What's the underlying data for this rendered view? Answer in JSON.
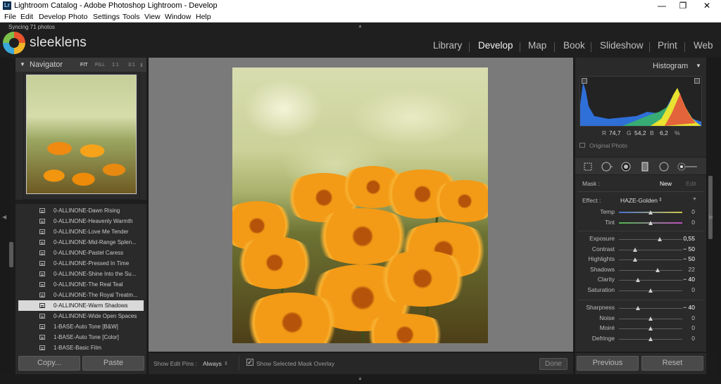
{
  "window": {
    "title": "Lightroom Catalog - Adobe Photoshop Lightroom - Develop",
    "app_icon": "Lr",
    "minimize": "—",
    "maximize": "❐",
    "close": "✕"
  },
  "menu": [
    "File",
    "Edit",
    "Develop",
    "Photo",
    "Settings",
    "Tools",
    "View",
    "Window",
    "Help"
  ],
  "identity": {
    "syncing": "Syncing 71 photos",
    "logo": "sleeklens"
  },
  "modules": [
    "Library",
    "Develop",
    "Map",
    "Book",
    "Slideshow",
    "Print",
    "Web"
  ],
  "active_module": "Develop",
  "navigator": {
    "title": "Navigator",
    "zoom_options": [
      "FIT",
      "FILL",
      "1:1",
      "3:1"
    ],
    "active_zoom": "FIT"
  },
  "presets": [
    "0-ALLINONE-Dawn Rising",
    "0-ALLINONE-Heavenly Warmth",
    "0-ALLINONE-Love Me Tender",
    "0-ALLINONE-Mid-Range Splen...",
    "0-ALLINONE-Pastel Caress",
    "0-ALLINONE-Pressed In Time",
    "0-ALLINONE-Shine Into the Su...",
    "0-ALLINONE-The Real Teal",
    "0-ALLINONE-The Royal Treatm...",
    "0-ALLINONE-Warm Shadows",
    "0-ALLINONE-Wide Open Spaces",
    "1-BASE-Auto Tone [B&W]",
    "1-BASE-Auto Tone [Color]",
    "1-BASE-Basic Film"
  ],
  "selected_preset": "0-ALLINONE-Warm Shadows",
  "left_buttons": {
    "copy": "Copy...",
    "paste": "Paste"
  },
  "toolbar": {
    "edit_pins_label": "Show Edit Pins :",
    "edit_pins_value": "Always",
    "mask_overlay_label": "Show Selected Mask Overlay",
    "mask_overlay_checked": true,
    "done": "Done"
  },
  "histogram": {
    "title": "Histogram",
    "r_label": "R",
    "r_value": "74,7",
    "g_label": "G",
    "g_value": "54,2",
    "b_label": "B",
    "b_value": "6,2",
    "percent": "%",
    "original_photo": "Original Photo"
  },
  "tool_icons": [
    "crop-icon",
    "spot-removal-icon",
    "red-eye-icon",
    "graduated-filter-icon",
    "radial-filter-icon",
    "adjustment-brush-icon"
  ],
  "mask": {
    "label": "Mask :",
    "new": "New",
    "edit": "Edit"
  },
  "effect": {
    "label": "Effect :",
    "value": "HAZE-Golden"
  },
  "adjustments": [
    {
      "label": "Temp",
      "value": "0",
      "pos": 0.5,
      "track": "temp",
      "group": 0
    },
    {
      "label": "Tint",
      "value": "0",
      "pos": 0.5,
      "track": "tint",
      "group": 0
    },
    {
      "label": "Exposure",
      "value": "0,55",
      "pos": 0.64,
      "group": 1,
      "bold": true
    },
    {
      "label": "Contrast",
      "value": "− 50",
      "pos": 0.25,
      "group": 1,
      "bold": true
    },
    {
      "label": "Highlights",
      "value": "− 50",
      "pos": 0.25,
      "group": 1,
      "bold": true
    },
    {
      "label": "Shadows",
      "value": "22",
      "pos": 0.61,
      "group": 1
    },
    {
      "label": "Clarity",
      "value": "− 40",
      "pos": 0.3,
      "group": 1,
      "bold": true
    },
    {
      "label": "Saturation",
      "value": "0",
      "pos": 0.5,
      "group": 1
    },
    {
      "label": "Sharpness",
      "value": "− 40",
      "pos": 0.3,
      "group": 2,
      "bold": true
    },
    {
      "label": "Noise",
      "value": "0",
      "pos": 0.5,
      "group": 2
    },
    {
      "label": "Moiré",
      "value": "0",
      "pos": 0.5,
      "group": 2
    },
    {
      "label": "Defringe",
      "value": "0",
      "pos": 0.5,
      "group": 2
    }
  ],
  "right_buttons": {
    "previous": "Previous",
    "reset": "Reset"
  }
}
